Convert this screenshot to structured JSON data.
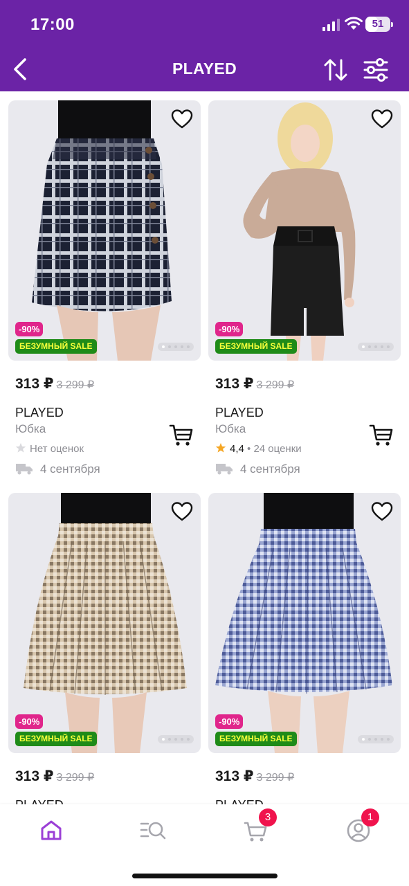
{
  "status_bar": {
    "time": "17:00",
    "battery": "51",
    "battery_level": 0.51
  },
  "header": {
    "title": "PLAYED",
    "back_icon": "chevron-left-icon",
    "sort_icon": "sort-icon",
    "filter_icon": "sliders-icon"
  },
  "colors": {
    "brand": "#6b23a6",
    "discount": "#e0258b",
    "sale_bg": "#1f8b18",
    "sale_text": "#f6ff3a",
    "badge": "#f0134d",
    "star": "#f5a623"
  },
  "products": [
    {
      "discount": "-90%",
      "sale": "БЕЗУМНЫЙ SALE",
      "price": "313 ₽",
      "old_price": "3 299 ₽",
      "brand": "PLAYED",
      "type": "Юбка",
      "rating": "",
      "rating_text": "Нет оценок",
      "reviews": "",
      "delivery": "4 сентября",
      "image": "plaid-mini-skirt"
    },
    {
      "discount": "-90%",
      "sale": "БЕЗУМНЫЙ SALE",
      "price": "313 ₽",
      "old_price": "3 299 ₽",
      "brand": "PLAYED",
      "type": "Юбка",
      "rating": "4,4",
      "rating_text": "",
      "reviews": "24 оценки",
      "delivery": "4 сентября",
      "image": "black-pencil-skirt"
    },
    {
      "discount": "-90%",
      "sale": "БЕЗУМНЫЙ SALE",
      "price": "313 ₽",
      "old_price": "3 299 ₽",
      "brand": "PLAYED",
      "image": "beige-pleated-skirt"
    },
    {
      "discount": "-90%",
      "sale": "БЕЗУМНЫЙ SALE",
      "price": "313 ₽",
      "old_price": "3 299 ₽",
      "brand": "PLAYED",
      "image": "blue-pleated-skirt"
    }
  ],
  "tabbar": [
    {
      "name": "home",
      "icon": "home-icon",
      "active": true,
      "badge": ""
    },
    {
      "name": "catalog",
      "icon": "catalog-search-icon",
      "active": false,
      "badge": ""
    },
    {
      "name": "cart",
      "icon": "cart-icon",
      "active": false,
      "badge": "3"
    },
    {
      "name": "profile",
      "icon": "profile-icon",
      "active": false,
      "badge": "1"
    }
  ]
}
